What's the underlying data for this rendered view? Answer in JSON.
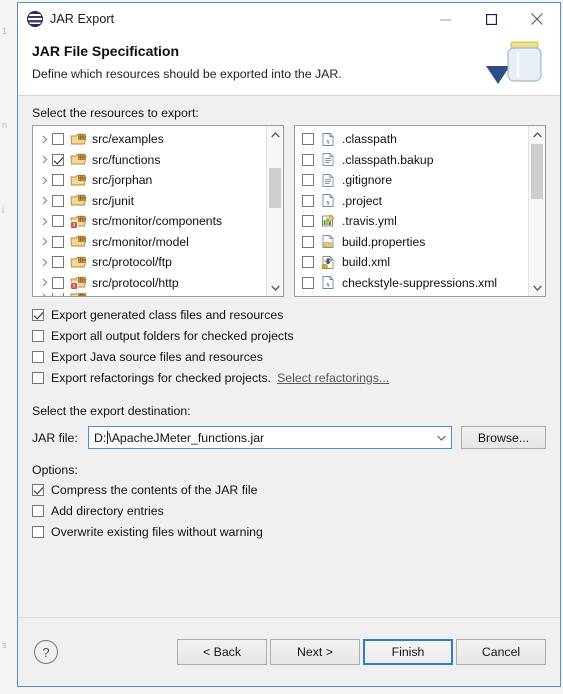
{
  "window": {
    "title": "JAR Export",
    "app_icon": "jar-export-icon",
    "controls": {
      "minimize": "minimize-icon",
      "maximize": "maximize-icon",
      "close": "close-icon"
    }
  },
  "banner": {
    "title": "JAR File Specification",
    "subtitle": "Define which resources should be exported into the JAR.",
    "graphic": "jar-jar-icon"
  },
  "resources": {
    "label": "Select the resources to export:",
    "tree": [
      {
        "label": "src/examples",
        "checked": false,
        "expandable": true,
        "icon": "package-folder-icon",
        "error": false
      },
      {
        "label": "src/functions",
        "checked": true,
        "expandable": true,
        "icon": "package-folder-icon",
        "error": false
      },
      {
        "label": "src/jorphan",
        "checked": false,
        "expandable": true,
        "icon": "package-folder-icon",
        "error": false
      },
      {
        "label": "src/junit",
        "checked": false,
        "expandable": true,
        "icon": "package-folder-icon",
        "error": false
      },
      {
        "label": "src/monitor/components",
        "checked": false,
        "expandable": true,
        "icon": "package-folder-error-icon",
        "error": true
      },
      {
        "label": "src/monitor/model",
        "checked": false,
        "expandable": true,
        "icon": "package-folder-icon",
        "error": false
      },
      {
        "label": "src/protocol/ftp",
        "checked": false,
        "expandable": true,
        "icon": "package-folder-icon",
        "error": false
      },
      {
        "label": "src/protocol/http",
        "checked": false,
        "expandable": true,
        "icon": "package-folder-error-icon",
        "error": true
      }
    ],
    "files": [
      {
        "label": ".classpath",
        "checked": false,
        "icon": "xml-file-icon"
      },
      {
        "label": ".classpath.bakup",
        "checked": false,
        "icon": "text-file-icon"
      },
      {
        "label": ".gitignore",
        "checked": false,
        "icon": "text-file-icon"
      },
      {
        "label": ".project",
        "checked": false,
        "icon": "xml-file-icon"
      },
      {
        "label": ".travis.yml",
        "checked": false,
        "icon": "yml-file-icon"
      },
      {
        "label": "build.properties",
        "checked": false,
        "icon": "properties-file-icon"
      },
      {
        "label": "build.xml",
        "checked": false,
        "icon": "ant-build-file-icon"
      },
      {
        "label": "checkstyle-suppressions.xml",
        "checked": false,
        "icon": "xml-file-icon"
      }
    ]
  },
  "export_options": [
    {
      "label": "Export generated class files and resources",
      "checked": true,
      "link": null
    },
    {
      "label": "Export all output folders for checked projects",
      "checked": false,
      "link": null
    },
    {
      "label": "Export Java source files and resources",
      "checked": false,
      "link": null
    },
    {
      "label": "Export refactorings for checked projects.",
      "checked": false,
      "link": "Select refactorings..."
    }
  ],
  "destination": {
    "label": "Select the export destination:",
    "field_label": "JAR file:",
    "value_prefix": "D:",
    "value_suffix": "\\ApacheJMeter_functions.jar",
    "value": "D:\\ApacheJMeter_functions.jar",
    "browse_label": "Browse...",
    "dropdown_icon": "chevron-down-icon"
  },
  "options": {
    "title": "Options:",
    "items": [
      {
        "label": "Compress the contents of the JAR file",
        "checked": true
      },
      {
        "label": "Add directory entries",
        "checked": false
      },
      {
        "label": "Overwrite existing files without warning",
        "checked": false
      }
    ]
  },
  "footer": {
    "help": "?",
    "buttons": [
      {
        "label": "< Back",
        "default": false
      },
      {
        "label": "Next >",
        "default": false
      },
      {
        "label": "Finish",
        "default": true
      },
      {
        "label": "Cancel",
        "default": false
      }
    ]
  },
  "background": {
    "left_marks": [
      "1",
      "n",
      "i",
      "s"
    ]
  },
  "colors": {
    "accent": "#2a7fd4",
    "dialog_border": "#5b8fc9",
    "field_focus": "#4a90d9",
    "dialog_bg": "#f0f0f0"
  }
}
